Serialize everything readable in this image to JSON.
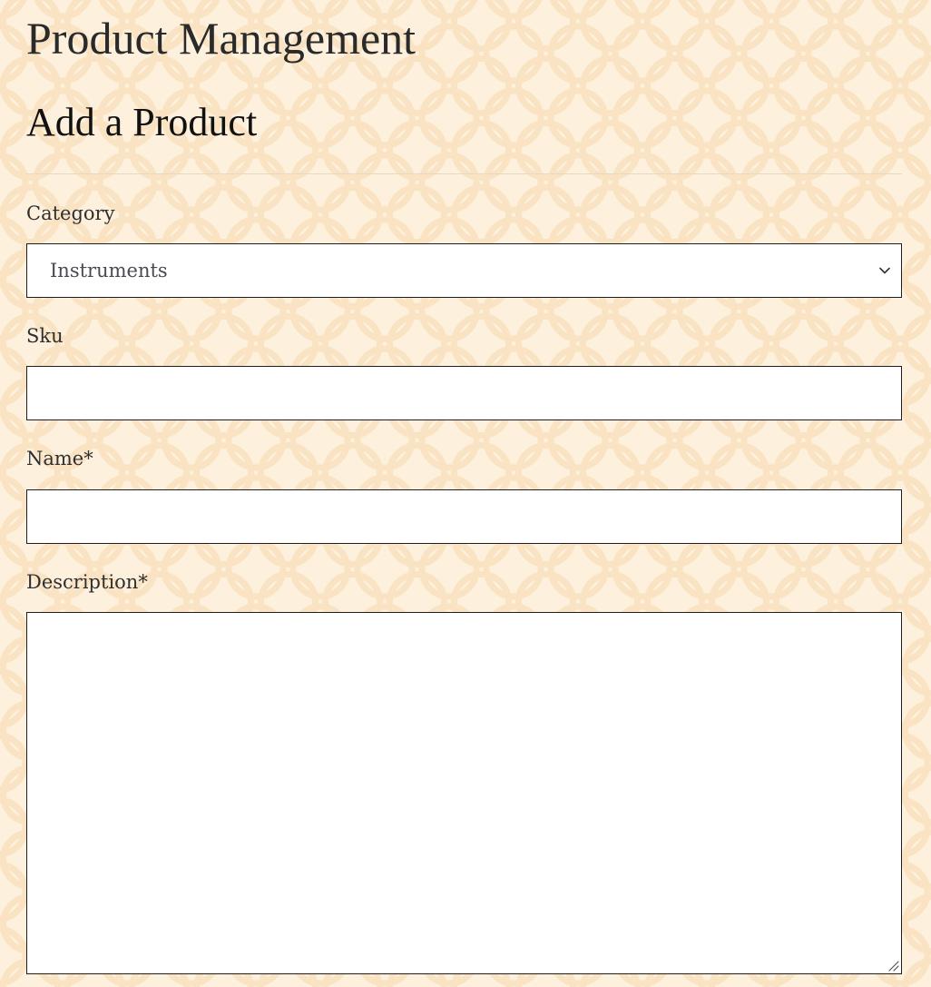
{
  "header": {
    "page_title": "Product Management",
    "section_title": "Add a Product"
  },
  "form": {
    "category": {
      "label": "Category",
      "selected_value": "Instruments"
    },
    "sku": {
      "label": "Sku",
      "value": ""
    },
    "name": {
      "label": "Name*",
      "value": ""
    },
    "description": {
      "label": "Description*",
      "value": ""
    }
  },
  "icons": {
    "dropdown": "chevron-down-icon",
    "resize": "resize-grip-icon"
  },
  "colors": {
    "background": "#fdf0dc",
    "pattern": "#f9e3c2",
    "text": "#2b2b2b",
    "field_border": "#1e1e1e"
  }
}
